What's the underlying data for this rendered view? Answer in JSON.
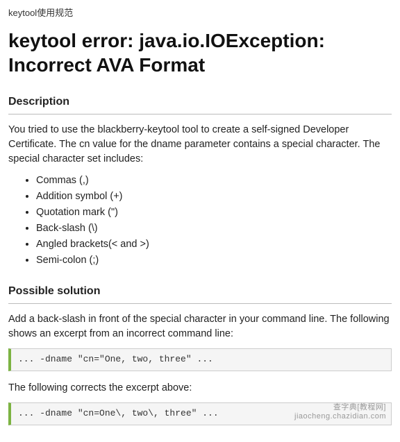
{
  "breadcrumb": "keytool使用规范",
  "title": "keytool error: java.io.IOException: Incorrect AVA Format",
  "sections": {
    "description": {
      "heading": "Description",
      "intro": "You tried to use the blackberry-keytool tool to create a self-signed Developer Certificate. The cn value for the dname parameter contains a special character. The special character set includes:",
      "chars": [
        "Commas (,)",
        "Addition symbol (+)",
        "Quotation mark (\")",
        "Back-slash (\\)",
        "Angled brackets(< and >)",
        "Semi-colon (;)"
      ]
    },
    "solution": {
      "heading": "Possible solution",
      "intro": "Add a back-slash in front of the special character in your command line. The following shows an excerpt from an incorrect command line:",
      "code_bad": "... -dname \"cn=\"One, two, three\" ...",
      "after_text": "The following corrects the excerpt above:",
      "code_good": "... -dname \"cn=One\\, two\\, three\" ..."
    }
  },
  "watermark": {
    "line1": "查字典[教程网]",
    "line2": "jiaocheng.chazidian.com"
  }
}
